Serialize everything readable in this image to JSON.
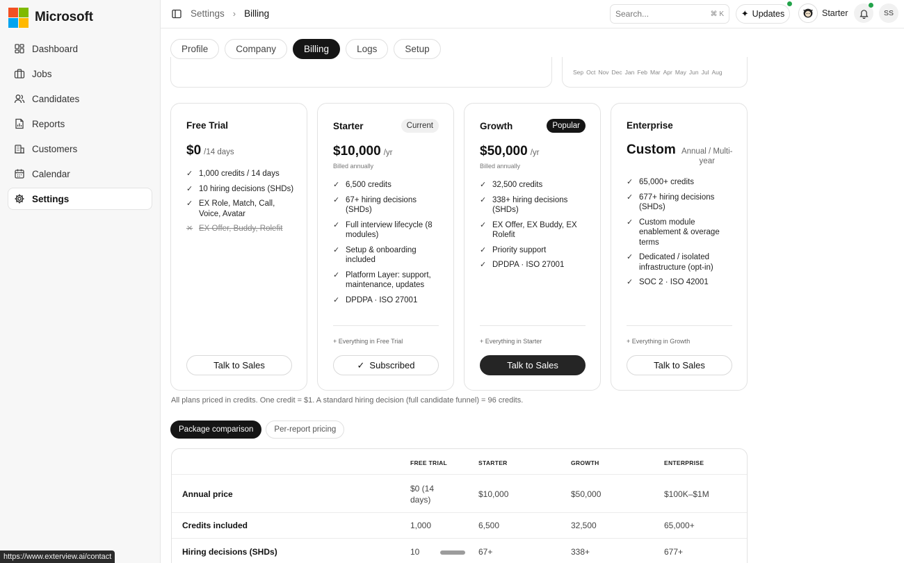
{
  "brand": {
    "name": "Microsoft",
    "logo_colors": [
      "#f25022",
      "#7fba00",
      "#00a4ef",
      "#ffb900"
    ]
  },
  "sidebar": {
    "items": [
      {
        "label": "Dashboard",
        "icon": "dashboard-icon",
        "active": false
      },
      {
        "label": "Jobs",
        "icon": "briefcase-icon",
        "active": false
      },
      {
        "label": "Candidates",
        "icon": "users-icon",
        "active": false
      },
      {
        "label": "Reports",
        "icon": "report-icon",
        "active": false
      },
      {
        "label": "Customers",
        "icon": "building-icon",
        "active": false
      },
      {
        "label": "Calendar",
        "icon": "calendar-icon",
        "active": false
      },
      {
        "label": "Settings",
        "icon": "gear-icon",
        "active": true
      }
    ]
  },
  "topbar": {
    "breadcrumb": [
      "Settings",
      "Billing"
    ],
    "search_placeholder": "Search...",
    "search_shortcut": "⌘ K",
    "updates_label": "Updates",
    "plan_label": "Starter",
    "user_initials": "SS",
    "notification_dot_color": "#22a34a"
  },
  "tabs": [
    {
      "label": "Profile",
      "active": false
    },
    {
      "label": "Company",
      "active": false
    },
    {
      "label": "Billing",
      "active": true
    },
    {
      "label": "Logs",
      "active": false
    },
    {
      "label": "Setup",
      "active": false
    }
  ],
  "usage_months": [
    "Sep",
    "Oct",
    "Nov",
    "Dec",
    "Jan",
    "Feb",
    "Mar",
    "Apr",
    "May",
    "Jun",
    "Jul",
    "Aug"
  ],
  "plans": [
    {
      "name": "Free Trial",
      "badge": "",
      "price": "$0",
      "per": "/14 days",
      "billed": "",
      "features": [
        {
          "text": "1,000 credits / 14 days",
          "included": true
        },
        {
          "text": "10 hiring decisions (SHDs)",
          "included": true
        },
        {
          "text": "EX Role, Match, Call, Voice, Avatar",
          "included": true
        },
        {
          "text": "EX Offer, Buddy, Rolefit",
          "included": false
        }
      ],
      "includes": "",
      "cta": "Talk to Sales"
    },
    {
      "name": "Starter",
      "badge": "Current",
      "price": "$10,000",
      "per": "/yr",
      "billed": "Billed annually",
      "features": [
        {
          "text": "6,500 credits",
          "included": true
        },
        {
          "text": "67+ hiring decisions (SHDs)",
          "included": true
        },
        {
          "text": "Full interview lifecycle (8 modules)",
          "included": true
        },
        {
          "text": "Setup & onboarding included",
          "included": true
        },
        {
          "text": "Platform Layer: support, maintenance, updates",
          "included": true
        },
        {
          "text": "DPDPA · ISO 27001",
          "included": true
        }
      ],
      "includes": "+ Everything in Free Trial",
      "cta": "Subscribed"
    },
    {
      "name": "Growth",
      "badge": "Popular",
      "price": "$50,000",
      "per": "/yr",
      "billed": "Billed annually",
      "features": [
        {
          "text": "32,500 credits",
          "included": true
        },
        {
          "text": "338+ hiring decisions (SHDs)",
          "included": true
        },
        {
          "text": "EX Offer, EX Buddy, EX Rolefit",
          "included": true
        },
        {
          "text": "Priority support",
          "included": true
        },
        {
          "text": "DPDPA · ISO 27001",
          "included": true
        }
      ],
      "includes": "+ Everything in Starter",
      "cta": "Talk to Sales"
    },
    {
      "name": "Enterprise",
      "badge": "",
      "price": "Custom",
      "per": "Annual / Multi-year",
      "billed": "",
      "features": [
        {
          "text": "65,000+ credits",
          "included": true
        },
        {
          "text": "677+ hiring decisions (SHDs)",
          "included": true
        },
        {
          "text": "Custom module enablement & overage terms",
          "included": true
        },
        {
          "text": "Dedicated / isolated infrastructure (opt-in)",
          "included": true
        },
        {
          "text": "SOC 2 · ISO 42001",
          "included": true
        }
      ],
      "includes": "+ Everything in Growth",
      "cta": "Talk to Sales"
    }
  ],
  "footnote": "All plans priced in credits. One credit = $1. A standard hiring decision (full candidate funnel) = 96 credits.",
  "pricing_toggle": [
    {
      "label": "Package comparison",
      "active": true
    },
    {
      "label": "Per-report pricing",
      "active": false
    }
  ],
  "comparison": {
    "headers": [
      "FREE TRIAL",
      "STARTER",
      "GROWTH",
      "ENTERPRISE"
    ],
    "rows": [
      {
        "label": "Annual price",
        "values": [
          "$0 (14 days)",
          "$10,000",
          "$50,000",
          "$100K–$1M"
        ]
      },
      {
        "label": "Credits included",
        "values": [
          "1,000",
          "6,500",
          "32,500",
          "65,000+"
        ]
      },
      {
        "label": "Hiring decisions (SHDs)",
        "values": [
          "10",
          "67+",
          "338+",
          "677+"
        ]
      }
    ]
  },
  "status_url": "https://www.exterview.ai/contact"
}
